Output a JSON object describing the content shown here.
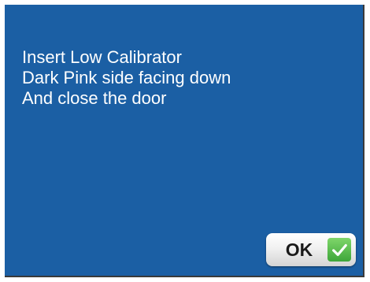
{
  "dialog": {
    "message_lines": [
      "Insert Low Calibrator",
      "Dark Pink side facing down",
      "And close the door"
    ],
    "ok_label": "OK",
    "icons": {
      "confirm": "checkmark-icon"
    },
    "colors": {
      "background": "#1b5fa4",
      "text": "#ffffff",
      "check": "#3ea63a"
    }
  }
}
